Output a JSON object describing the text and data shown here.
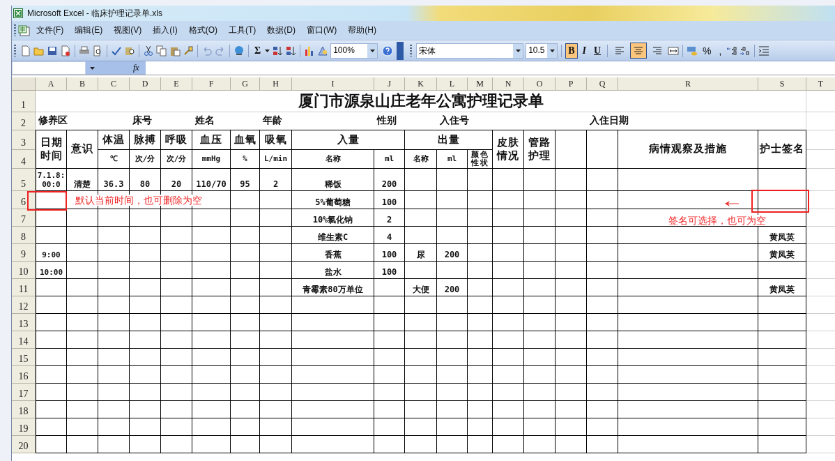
{
  "window": {
    "title": "Microsoft Excel - 临床护理记录单.xls"
  },
  "menu": [
    "文件(F)",
    "编辑(E)",
    "视图(V)",
    "插入(I)",
    "格式(O)",
    "工具(T)",
    "数据(D)",
    "窗口(W)",
    "帮助(H)"
  ],
  "standard_toolbar": {
    "autosum": "Σ",
    "zoom": "100%"
  },
  "formatting_toolbar": {
    "font": "宋体",
    "size": "10.5",
    "styles": [
      {
        "label": "B",
        "selected": true
      },
      {
        "label": "I",
        "selected": false
      },
      {
        "label": "U",
        "selected": false
      }
    ],
    "align": [
      {
        "selected": false
      },
      {
        "selected": true
      },
      {
        "selected": false
      }
    ],
    "percent": "%",
    "comma": ","
  },
  "formula_bar": {
    "fx": "fx"
  },
  "sheet": {
    "columns": [
      "A",
      "B",
      "C",
      "D",
      "E",
      "F",
      "G",
      "H",
      "I",
      "J",
      "K",
      "L",
      "M",
      "N",
      "O",
      "P",
      "Q",
      "R",
      "S",
      "T"
    ],
    "rows": [
      {
        "number": "1",
        "cells": {
          "A": "厦门市源泉山庄老年公寓护理记录单"
        }
      },
      {
        "number": "2",
        "cells": {
          "A": "修养区",
          "D": "床号",
          "F": "姓名",
          "H": "年龄",
          "J": "性别",
          "L": "入住号",
          "Q": "入住日期"
        }
      },
      {
        "number": "3",
        "cells": {
          "A": "日期时间",
          "B": "意识",
          "C": "体温",
          "D": "脉搏",
          "E": "呼吸",
          "F": "血压",
          "G": "血氧",
          "H": "吸氧",
          "I": "入量",
          "K": "出量",
          "N": "皮肤情况",
          "O": "管路护理",
          "R": "病情观察及措施",
          "S": "护士签名"
        }
      },
      {
        "number": "4",
        "cells": {
          "C": "℃",
          "D": "次/分",
          "E": "次/分",
          "F": "mmHg",
          "G": "%",
          "H": "L/min",
          "I": "名称",
          "J": "ml",
          "K": "名称",
          "L": "ml",
          "M": "颜色性状"
        }
      },
      {
        "number": "5",
        "cells": {
          "A": "7.1.8:00:0",
          "B": "清楚",
          "C": "36.3",
          "D": "80",
          "E": "20",
          "F": "110/70",
          "G": "95",
          "H": "2",
          "I": "稀饭",
          "J": "200"
        }
      },
      {
        "number": "6",
        "cells": {
          "I": "5%葡萄糖",
          "J": "100"
        }
      },
      {
        "number": "7",
        "cells": {
          "I": "10%氯化钠",
          "J": "2"
        }
      },
      {
        "number": "8",
        "cells": {
          "I": "维生素C",
          "J": "4",
          "S": "黄凤英"
        }
      },
      {
        "number": "9",
        "cells": {
          "A": "9:00",
          "I": "香蕉",
          "J": "100",
          "K": "尿",
          "L": "200",
          "S": "黄凤英"
        }
      },
      {
        "number": "10",
        "cells": {
          "A": "10:00",
          "I": "盐水",
          "J": "100"
        }
      },
      {
        "number": "11",
        "cells": {
          "I": "青霉素80万单位",
          "K": "大便",
          "L": "200",
          "S": "黄凤英"
        }
      },
      {
        "number": "12",
        "cells": {}
      },
      {
        "number": "13",
        "cells": {}
      },
      {
        "number": "14",
        "cells": {}
      },
      {
        "number": "15",
        "cells": {}
      },
      {
        "number": "16",
        "cells": {}
      },
      {
        "number": "17",
        "cells": {}
      },
      {
        "number": "18",
        "cells": {}
      },
      {
        "number": "19",
        "cells": {}
      },
      {
        "number": "20",
        "cells": {}
      }
    ]
  },
  "annotations": [
    {
      "text": "默认当前时间，也可删除为空"
    },
    {
      "text": "签名可选择，也可为空"
    }
  ]
}
